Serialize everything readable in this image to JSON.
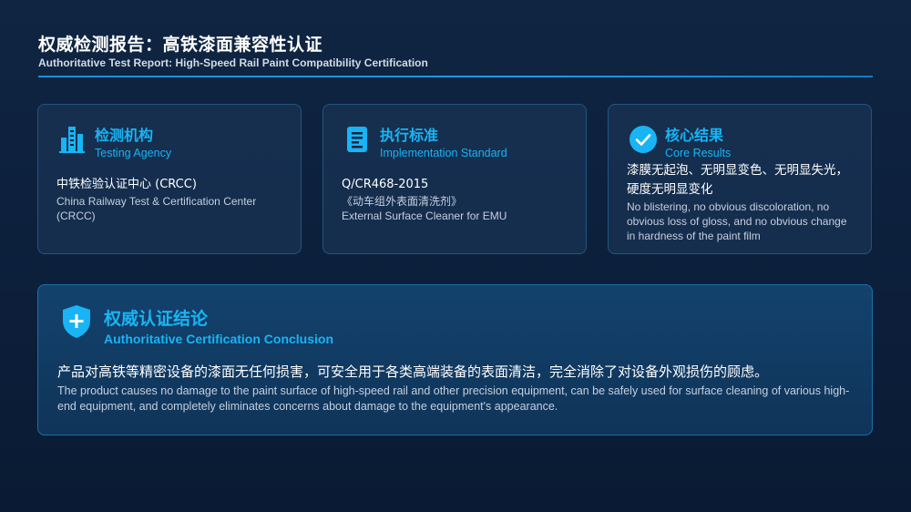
{
  "header": {
    "title": "权威检测报告：高铁漆面兼容性认证",
    "subtitle": "Authoritative Test Report: High-Speed Rail Paint Compatibility Certification"
  },
  "cards": [
    {
      "icon": "building-icon",
      "title_cn": "检测机构",
      "title_en": "Testing Agency",
      "body_cn": "中铁检验认证中心 (CRCC)",
      "body_en": "China Railway Test & Certification Center (CRCC)"
    },
    {
      "icon": "document-icon",
      "title_cn": "执行标准",
      "title_en": "Implementation Standard",
      "body_code": "Q/CR468-2015",
      "body_cn": "《动车组外表面清洗剂》",
      "body_en": "External Surface Cleaner for EMU"
    },
    {
      "icon": "checkmark-circle-icon",
      "title_cn": "核心结果",
      "title_en": "Core Results",
      "body_cn": "漆膜无起泡、无明显变色、无明显失光，硬度无明显变化",
      "body_en": "No blistering, no obvious discoloration, no obvious loss of gloss, and no obvious change in hardness of the paint film"
    }
  ],
  "conclusion": {
    "icon": "shield-plus-icon",
    "title_cn": "权威认证结论",
    "title_en": "Authoritative Certification Conclusion",
    "body_cn": "产品对高铁等精密设备的漆面无任何损害，可安全用于各类高端装备的表面清洁，完全消除了对设备外观损伤的顾虑。",
    "body_en": "The product causes no damage to the paint surface of high-speed rail and other precision equipment, can be safely used for surface cleaning of various high-end equipment, and completely eliminates concerns about damage to the equipment's appearance."
  },
  "colors": {
    "accent": "#19b4f5",
    "background": "#0f2542"
  }
}
